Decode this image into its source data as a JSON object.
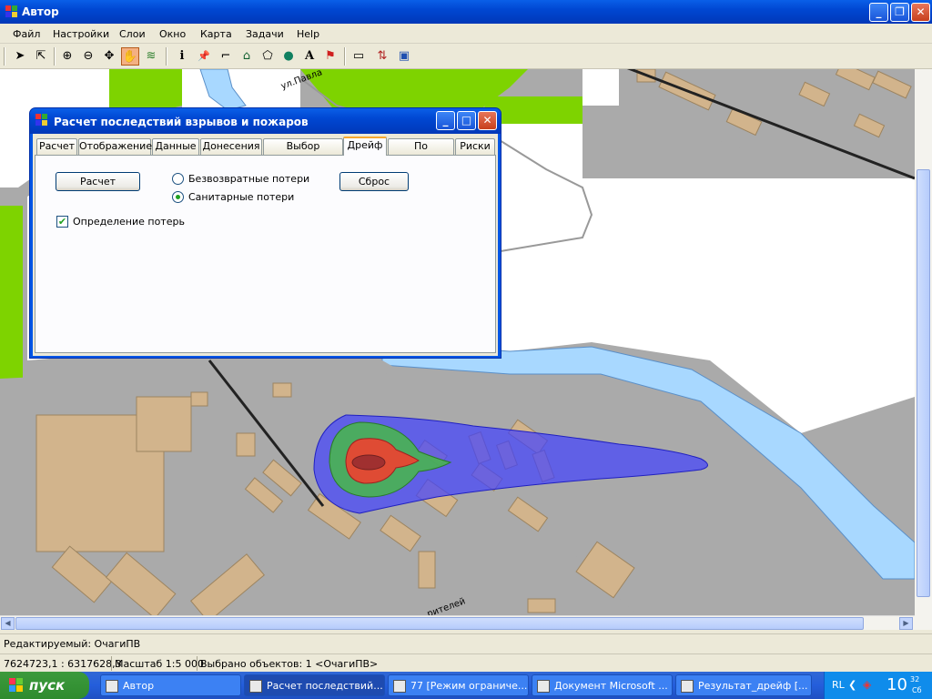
{
  "window": {
    "title": "Автор",
    "min_icon": "minimize-icon",
    "max_icon": "restore-icon",
    "close_icon": "close-icon"
  },
  "menu": [
    "Файл",
    "Настройки",
    "Слои",
    "Окно",
    "Карта",
    "Задачи",
    "Help"
  ],
  "toolbar": [
    {
      "name": "select-arrow-icon",
      "glyph": "➤"
    },
    {
      "name": "select-area-icon",
      "glyph": "⇱"
    },
    {
      "name": "zoom-in-icon",
      "glyph": "⊕"
    },
    {
      "name": "zoom-out-icon",
      "glyph": "⊖"
    },
    {
      "name": "pan-move-icon",
      "glyph": "✥"
    },
    {
      "name": "hand-icon",
      "glyph": "✋"
    },
    {
      "name": "layers-icon",
      "glyph": "≋"
    },
    {
      "name": "info-icon",
      "glyph": "i"
    },
    {
      "name": "pin-icon",
      "glyph": "📌"
    },
    {
      "name": "polyline-icon",
      "glyph": "⌐"
    },
    {
      "name": "house-icon",
      "glyph": "⌂"
    },
    {
      "name": "polygon-icon",
      "glyph": "⬠"
    },
    {
      "name": "ellipse-icon",
      "glyph": "●"
    },
    {
      "name": "text-icon",
      "glyph": "A"
    },
    {
      "name": "flag-icon",
      "glyph": "⚑"
    },
    {
      "name": "ruler-icon",
      "glyph": "▭"
    },
    {
      "name": "graph-icon",
      "glyph": "⇅"
    },
    {
      "name": "image-icon",
      "glyph": "▣"
    }
  ],
  "map": {
    "street_label_1": "ул.Павла",
    "street_label_2": "рителей",
    "colors": {
      "background": "#aaaaaa",
      "roads": "#ffffff",
      "parks": "#7ed300",
      "buildings": "#d2b48c",
      "water": "#a8d8ff",
      "plume": "#4040ff",
      "zone_green": "#48b848",
      "zone_red": "#f04030",
      "core": "#a03030"
    }
  },
  "dialog": {
    "title": "Расчет последствий взрывов и пожаров",
    "tabs": [
      "Расчет",
      "Отображение",
      "Данные",
      "Донесения",
      "Выбор объекта",
      "Дрейф",
      "По площади",
      "Риски"
    ],
    "selected_tab": "Дрейф",
    "calc_button": "Расчет",
    "reset_button": "Сброс",
    "radio_irrecoverable": "Безвозвратные потери",
    "radio_sanitary": "Санитарные потери",
    "radio_selected": "Санитарные потери",
    "checkbox_label": "Определение потерь",
    "checkbox_checked": true
  },
  "status": {
    "editing": "Редактируемый: ОчагиПВ",
    "coords": "7624723,1 : 6317628,3",
    "scale": "Масштаб 1:5 000",
    "selected": "Выбрано объектов: 1 <ОчагиПВ>"
  },
  "taskbar": {
    "start": "пуск",
    "tasks": [
      "Автор",
      "Расчет последствий...",
      "77 [Режим ограниче...",
      "Документ Microsoft ...",
      "Результат_дрейф [..."
    ],
    "active_task": "Расчет последствий...",
    "lang": "RL",
    "time_big": "10",
    "time_small": "32",
    "day": "Сб"
  }
}
